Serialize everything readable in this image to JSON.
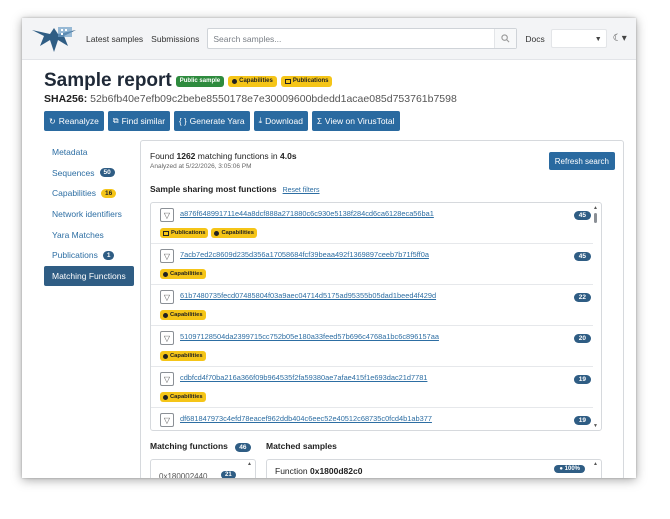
{
  "navbar": {
    "nav_latest": "Latest samples",
    "nav_submissions": "Submissions",
    "search_placeholder": "Search samples...",
    "docs": "Docs"
  },
  "header": {
    "title": "Sample report",
    "badges": [
      "Public sample",
      "Capabilities",
      "Publications"
    ],
    "sha_label": "SHA256:",
    "sha_value": "52b6fb40e7efb09c2bebe8550178e7e30009600bdedd1acae085d753761b7598"
  },
  "actions": [
    "Reanalyze",
    "Find similar",
    "Generate Yara",
    "Download",
    "View on VirusTotal"
  ],
  "sidebar": {
    "items": [
      {
        "label": "Metadata",
        "count": ""
      },
      {
        "label": "Sequences",
        "count": "50"
      },
      {
        "label": "Capabilities",
        "count": "16"
      },
      {
        "label": "Network identifiers",
        "count": ""
      },
      {
        "label": "Yara Matches",
        "count": ""
      },
      {
        "label": "Publications",
        "count": "1"
      },
      {
        "label": "Matching Functions",
        "count": ""
      }
    ]
  },
  "panel": {
    "found_prefix": "Found",
    "found_count": "1262",
    "found_mid": "matching functions in",
    "found_time": "4.0s",
    "analyzed": "Analyzed at 5/22/2026, 3:05:06 PM",
    "refresh": "Refresh search",
    "sharing_title": "Sample sharing most functions",
    "reset": "Reset filters",
    "samples": [
      {
        "hash": "a876f648991711e44a8dcf888a271880c6c930e5138f284cd6ca6128eca56ba1",
        "tags": [
          "Publications",
          "Capabilities"
        ],
        "count": "45"
      },
      {
        "hash": "7acb7ed2c8609d235d356a17058684fcf39beaa492f1369897ceeb7b71f5ff0a",
        "tags": [
          "Capabilities"
        ],
        "count": "45"
      },
      {
        "hash": "61b7480735fecd07485804f03a9aec04714d5175ad95355b05dad1beed4f429d",
        "tags": [
          "Capabilities"
        ],
        "count": "22"
      },
      {
        "hash": "51097128504da2399715cc752b05e180a33feed57b696c4768a1bc6c896157aa",
        "tags": [
          "Capabilities"
        ],
        "count": "20"
      },
      {
        "hash": "cdbfcd4f70ba216a366f09b964535f2fa59380ae7afae415f1e693dac21d7781",
        "tags": [
          "Capabilities"
        ],
        "count": "19"
      },
      {
        "hash": "df681847973c4efd78eacef962ddb404c6eec52e40512c68735c0fcd4b1ab377",
        "tags": [],
        "count": "19"
      }
    ],
    "matching_functions_label": "Matching functions",
    "matching_functions_count": "46",
    "matched_samples_label": "Matched samples",
    "mf_first": "0x180002440",
    "mf_first_count": "21",
    "function_prefix": "Function",
    "function_addr": "0x1800d82c0",
    "function_pct": "100%"
  }
}
